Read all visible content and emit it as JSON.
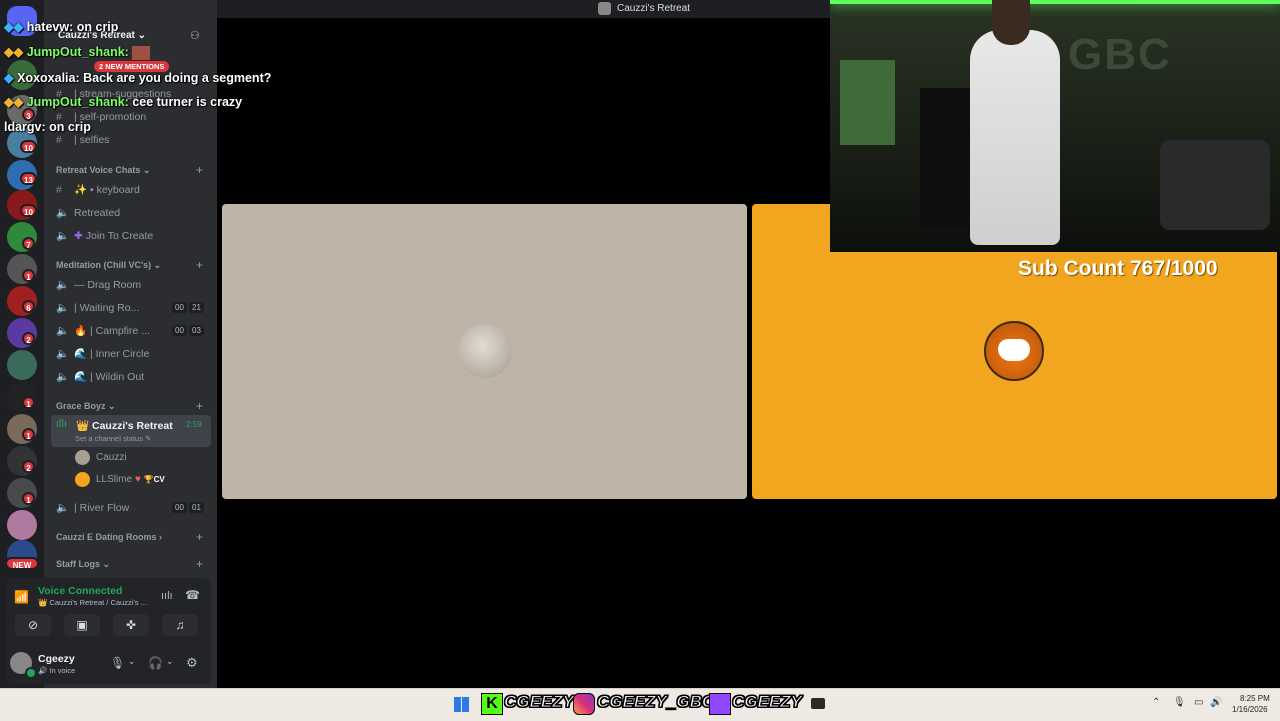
{
  "window": {
    "title": "Cauzzi's Retreat"
  },
  "server": {
    "name": "Cauzzi's Retreat",
    "new_mentions": "2 NEW MENTIONS"
  },
  "rail": {
    "badges": [
      "3",
      "10",
      "13",
      "10",
      "7",
      "1",
      "6",
      "2",
      "1",
      "1",
      "2",
      "1",
      "NEW"
    ]
  },
  "channels": {
    "text": [
      {
        "name": "| stream-suggestions"
      },
      {
        "name": "| self-promotion"
      },
      {
        "name": "| selfies"
      }
    ],
    "categories": {
      "retreat_voice": "Retreat Voice Chats",
      "meditation": "Meditation (Chill VC's)",
      "grace_boyz": "Grace Boyz",
      "dating": "Cauzzi E Dating Rooms",
      "staff": "Staff Logs"
    },
    "retreat_items": [
      "keyboard",
      "Retreated",
      "Join To Create"
    ],
    "meditation_items": [
      {
        "name": "Drag Room"
      },
      {
        "name": "| Waiting Ro...",
        "c1": "00",
        "c2": "21"
      },
      {
        "name": "| Campfire ...",
        "c1": "00",
        "c2": "03"
      },
      {
        "name": "| Inner Circle"
      },
      {
        "name": "| Wildin Out"
      }
    ],
    "active": {
      "name": "Cauzzi's Retreat",
      "time": "2:59",
      "status": "Set a channel status"
    },
    "members": [
      "Cauzzi",
      "LLSlime"
    ],
    "member_tag": "CV",
    "river_flow": {
      "name": "| River Flow",
      "c1": "00",
      "c2": "01"
    }
  },
  "voice": {
    "status": "Voice Connected",
    "location": "Cauzzi's Retreat / Cauzzi's ..."
  },
  "user": {
    "name": "Cgeezy",
    "status": "In voice"
  },
  "overlay": {
    "sub_count": "Sub Count 767/1000",
    "cam_sign": "GBC"
  },
  "chat": [
    {
      "user": "hatevw:",
      "msg": "on crip"
    },
    {
      "user": "JumpOut_shank:",
      "msg": ""
    },
    {
      "user": "Xoxoxalia:",
      "msg": "Back are you doing a segment?"
    },
    {
      "user": "JumpOut_shank:",
      "msg": "cee turner is crazy"
    },
    {
      "user": "ldargv:",
      "msg": "on crip"
    }
  ],
  "taskbar": {
    "kick": "CGEEZY",
    "instagram": "CGEEZY_GBC",
    "twitch": "CGEEZY",
    "time": "8:25 PM",
    "date": "1/16/2026"
  },
  "colors": {
    "tile_orange": "#f2a51f",
    "tile_beige": "#beb5a8",
    "online_green": "#23a55a"
  }
}
